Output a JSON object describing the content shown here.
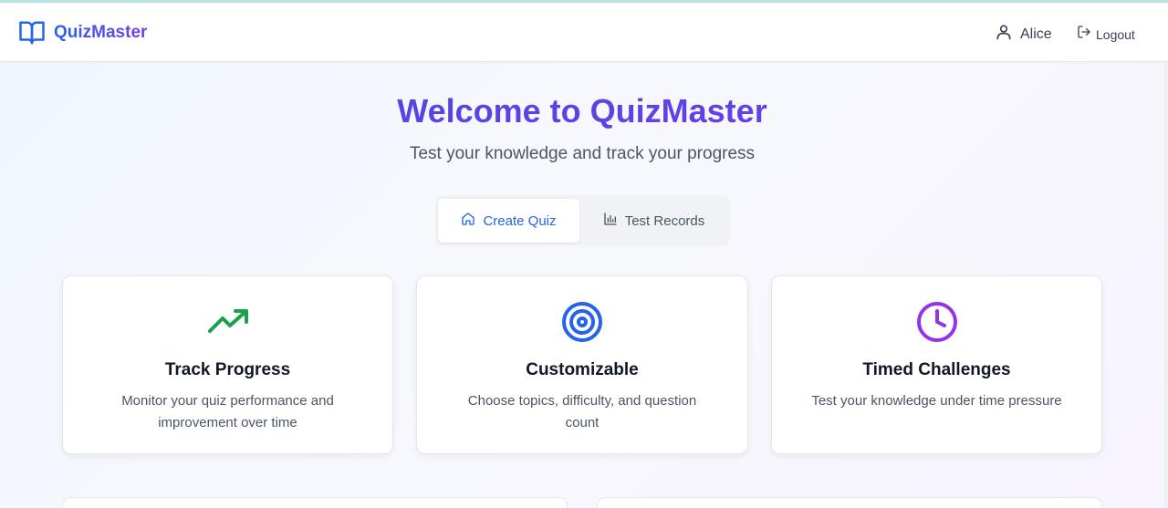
{
  "app": {
    "name": "QuizMaster",
    "brand_icon": "book-open-icon"
  },
  "nav": {
    "user_name": "Alice",
    "user_icon": "user-icon",
    "logout_label": "Logout",
    "logout_icon": "logout-icon"
  },
  "hero": {
    "title": "Welcome to QuizMaster",
    "subtitle": "Test your knowledge and track your progress"
  },
  "tabs": [
    {
      "label": "Create Quiz",
      "icon": "home-icon",
      "active": true
    },
    {
      "label": "Test Records",
      "icon": "bar-chart-icon",
      "active": false
    }
  ],
  "features": [
    {
      "title": "Track Progress",
      "description": "Monitor your quiz performance and improvement over time",
      "icon": "trending-up-icon",
      "color": "#16a34a"
    },
    {
      "title": "Customizable",
      "description": "Choose topics, difficulty, and question count",
      "icon": "target-icon",
      "color": "#2563eb"
    },
    {
      "title": "Timed Challenges",
      "description": "Test your knowledge under time pressure",
      "icon": "clock-icon",
      "color": "#9333ea"
    }
  ],
  "colors": {
    "primary": "#2563eb",
    "accent": "#7c3aed",
    "title_gradient_start": "#4f46e5"
  }
}
